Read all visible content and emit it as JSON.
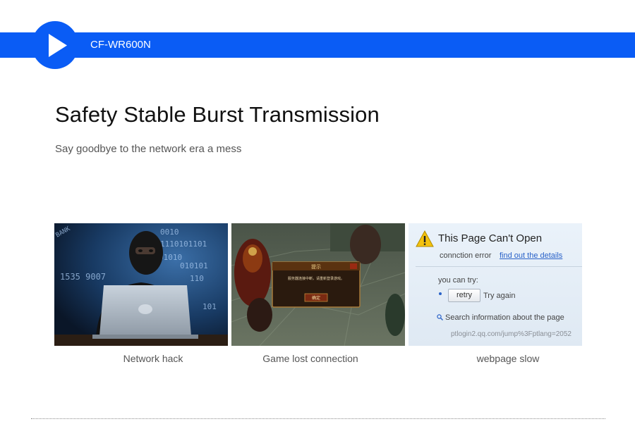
{
  "header": {
    "model": "CF-WR600N",
    "brand_color": "#0a5cf5"
  },
  "hero": {
    "headline": "Safety Stable Burst Transmission",
    "subline": "Say goodbye to the network era a mess"
  },
  "cards": [
    {
      "caption": "Network hack",
      "image": "hacker-with-laptop"
    },
    {
      "caption": "Game lost connection",
      "image": "game-disconnect-dialog"
    },
    {
      "caption": "webpage slow",
      "image": "browser-error-page"
    }
  ],
  "hacker_screen": {
    "numbers": [
      "0010",
      "1110101101",
      "01010",
      "010101",
      "1535 9007",
      "110",
      "101",
      "BANK"
    ]
  },
  "error_page": {
    "title": "This Page Can't Open",
    "subtitle": "connction error",
    "link": "find out the details",
    "try_label": "you can try:",
    "retry_button": "retry",
    "try_again": "Try again",
    "search_text": "Search information about the page",
    "url": "ptlogin2.qq.com/jump%3Fptlang=2052"
  },
  "game_dialog": {
    "title": "提示",
    "message": "服务器连接中断，请重新登录游戏。",
    "button": "确定"
  }
}
